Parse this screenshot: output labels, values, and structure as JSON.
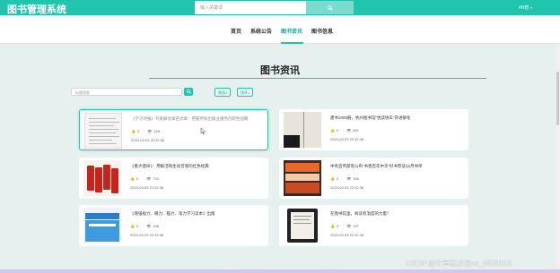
{
  "header": {
    "brand": "图书管理系统",
    "search_placeholder": "输入关键词",
    "user": "#N管"
  },
  "nav": {
    "items": [
      "首页",
      "系统公告",
      "图书资讯",
      "图书信息"
    ],
    "active_index": 2
  },
  "page": {
    "title": "图书资讯",
    "search_placeholder": "标题搜索",
    "filter_label": "筛选",
    "sort_label": "排序"
  },
  "articles": [
    {
      "title": "《学习时报》刊发解文章名文章：把握传统出版业服务创新性战略",
      "likes": "0",
      "views": "328",
      "date": "2024-03-03 22:32:36"
    },
    {
      "title": "建书1000册，杭州图书馆“悦读快车”开进暖冬",
      "likes": "0",
      "views": "881",
      "date": "2024-03-03 22:32:36"
    },
    {
      "title": "《重大使命》：用鲜活和生动可感的红色经典",
      "likes": "0",
      "views": "720",
      "date": "2024-03-03 22:32:36"
    },
    {
      "title": "中央宣传部等公布“书香百年中华”好书荐读12月书单",
      "likes": "0",
      "views": "306",
      "date": "2024-03-03 22:32:36"
    },
    {
      "title": "《增强视力、眼力、脑力、笔力学习读本》出版",
      "likes": "0",
      "views": "168",
      "date": "2024-03-03 22:32:36"
    },
    {
      "title": "在图书馆里，阅读有温度的力量！",
      "likes": "0",
      "views": "197",
      "date": "2024-03-03 22:32:36"
    }
  ],
  "watermark": "CSDN @计算机毕设vx_B530813",
  "colors": {
    "accent": "#21c5ad",
    "background": "#e6f0ee"
  }
}
